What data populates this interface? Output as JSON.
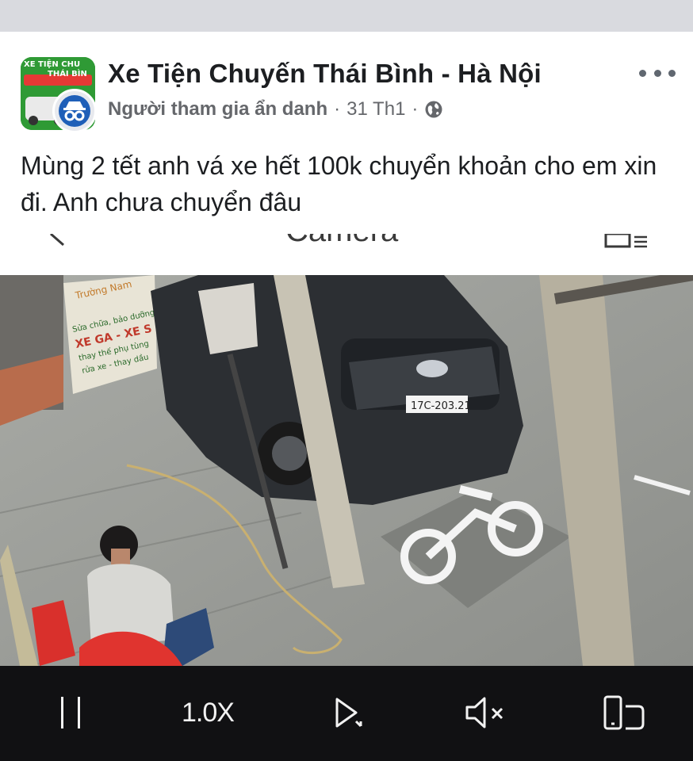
{
  "post": {
    "group_name": "Xe Tiện Chuyến Thái Bình - Hà Nội",
    "author": "Người tham gia ẩn danh",
    "date": "31 Th1",
    "separator": "·",
    "body": "Mùng 2 tết anh vá xe hết 100k chuyển khoản cho em xin đi. Anh chưa chuyển đâu",
    "avatar_text_line1": "XE TIỆN CHU",
    "avatar_text_line2": "THÁI BÌN"
  },
  "embedded_screenshot": {
    "title": "Camera"
  },
  "video": {
    "scene_signs": {
      "shop_line1": "Sửa chữa, bảo dưỡng",
      "shop_line2": "XE GA - XE S",
      "shop_line3": "thay thế phụ tùng",
      "shop_line4": "rửa xe - thay dầu",
      "shop_name": "Trường Nam"
    },
    "plate": "17C-203.21"
  },
  "controls": {
    "speed_label": "1.0X"
  },
  "colors": {
    "controls_bg": "#111113",
    "top_band": "#d9dadf",
    "brand_green": "#2f9a35"
  },
  "icons": {
    "pause": "pause-icon",
    "share": "share-icon",
    "mute": "muted-speaker-icon",
    "rotate": "rotate-screen-icon",
    "globe": "globe-icon",
    "more": "more-icon"
  }
}
